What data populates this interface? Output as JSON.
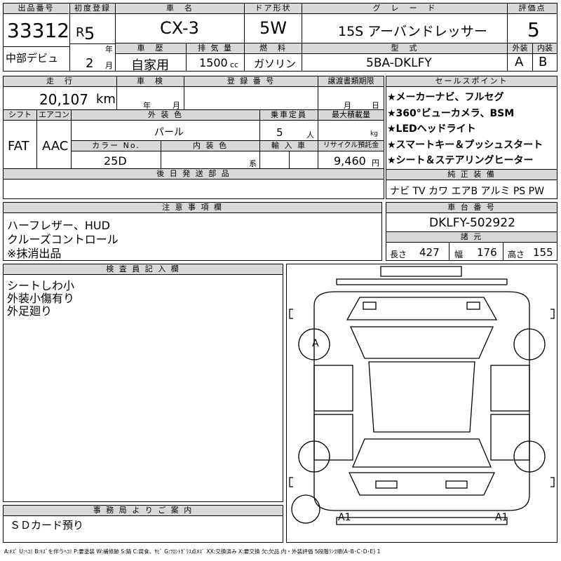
{
  "header": {
    "lot_label": "出品番号",
    "lot": "33312",
    "venue": "中部デビュ",
    "reg_label": "初度登録",
    "era": "R",
    "year": "5",
    "year_unit": "年",
    "month": "2",
    "month_unit": "月",
    "name_label": "車　名",
    "name": "CX-3",
    "door_label": "ドア形状",
    "door": "5W",
    "grade_label": "グ　レ　ー　ド",
    "grade": "15S アーバンドレッサー",
    "score_label": "評価点",
    "score": "5",
    "history_label": "車　歴",
    "history": "自家用",
    "displacement_label": "排 気 量",
    "displacement": "1500",
    "displacement_unit": "cc",
    "fuel_label": "燃　料",
    "fuel": "ガソリン",
    "model_label": "型　式",
    "model": "5BA-DKLFY",
    "ext_label": "外装",
    "ext": "A",
    "int_label": "内装",
    "int": "B"
  },
  "spec": {
    "mileage_label": "走　行",
    "mileage": "20,107",
    "mileage_unit": "km",
    "inspection_label": "車　検",
    "insp_year_unit": "年",
    "insp_month_unit": "月",
    "plate_label": "登 録 番 号",
    "transfer_label": "譲渡書類期限",
    "tr_month_unit": "月",
    "tr_day_unit": "日",
    "shift_label": "シフト",
    "shift": "FAT",
    "ac_label": "エアコン",
    "ac": "AAC",
    "color_label": "外 装 色",
    "color": "パール",
    "seats_label": "乗車定員",
    "seats": "5",
    "seats_unit": "人",
    "load_label": "最大積載量",
    "load_unit": "kg",
    "color_no_label": "カラー No.",
    "color_no": "25D",
    "int_color_label": "内 装 色",
    "int_color_unit": "系",
    "import_label": "輸 入 車",
    "recycle_label": "リサイクル預託金",
    "recycle": "9,460",
    "recycle_unit": "円",
    "later_parts_label": "後 日 発 送 部 品"
  },
  "sales": {
    "label": "セールスポイント",
    "points": [
      "★メーカーナビ、フルセグ",
      "★360°ビューカメラ、BSM",
      "★LEDヘッドライト",
      "★スマートキー＆プッシュスタート",
      "★シート＆ステアリングヒーター"
    ]
  },
  "equipment": {
    "label": "純 正 装 備",
    "items": "ナビ TV カワ エアB アルミ PS PW"
  },
  "notes": {
    "label": "注 意 事 項 欄",
    "lines": [
      "ハーフレザー、HUD",
      "クルーズコントロール",
      "※抹消出品"
    ]
  },
  "chassis": {
    "label": "車 台 番 号",
    "number": "DKLFY-502922",
    "dims_label": "諸 元",
    "length_label": "長さ",
    "length": "427",
    "width_label": "幅",
    "width": "176",
    "height_label": "高さ",
    "height": "155"
  },
  "inspector": {
    "label": "検 査 員 記 入 欄",
    "lines": [
      "シートしわ小",
      "外装小傷有り",
      "外足廻り"
    ]
  },
  "office": {
    "label": "事 務 局 よ り ご 案 内",
    "text": "ＳＤカード預り"
  },
  "diagram": {
    "mark_a": "A",
    "mark_a1_left": "A1",
    "mark_a1_right": "A1"
  },
  "legend": "A:ｷｽﾞ U:ﾍｺﾐ B:ｷｽﾞを伴うﾍｺﾐ P:要塗装 W:補修跡 S:錆 C:腐食、ｻﾋﾞ G:ﾌﾛﾝﾄｶﾞﾗｽ点ｷｽﾞ XX:交換済み X:要交換 欠:欠品 内・外装評価 5段階ﾗﾝｸ順(A･B･C･D･E) 1"
}
